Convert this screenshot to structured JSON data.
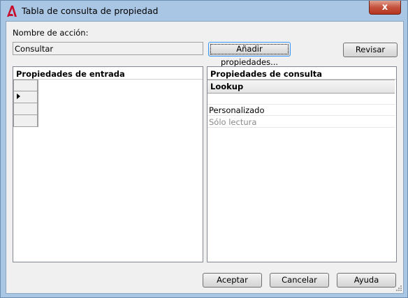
{
  "window": {
    "title": "Tabla de consulta de propiedad",
    "close_glyph": "x"
  },
  "action": {
    "label": "Nombre de acción:",
    "value": "Consultar"
  },
  "buttons": {
    "add_properties": "Añadir propiedades...",
    "review": "Revisar",
    "accept": "Aceptar",
    "cancel": "Cancelar",
    "help": "Ayuda"
  },
  "input_panel": {
    "header": "Propiedades de entrada",
    "rows": 4,
    "current_row_index": 1
  },
  "lookup_panel": {
    "header": "Propiedades de consulta",
    "column_header": "Lookup",
    "rows": [
      "",
      "Personalizado",
      "Sólo lectura"
    ]
  },
  "icons": [
    "autocad-app-icon",
    "close-icon",
    "row-pointer-icon",
    "size-grip-icon"
  ]
}
